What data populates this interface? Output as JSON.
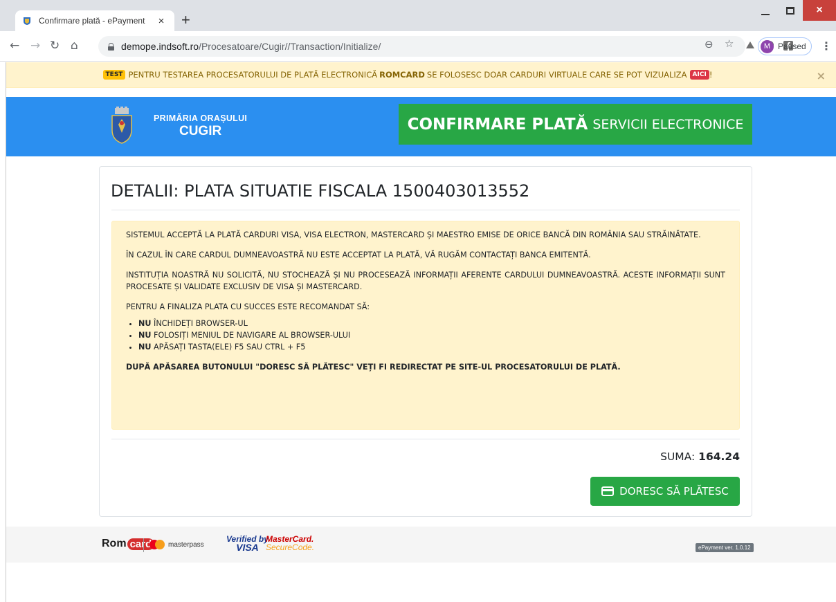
{
  "browser": {
    "tab_title": "Confirmare plată - ePayment",
    "tab_close": "×",
    "new_tab": "+",
    "url_host": "demope.indsoft.ro",
    "url_path": "/Procesatoare/Cugir//Transaction/Initialize/",
    "profile_initial": "M",
    "profile_label": "Paused",
    "close_glyph": "×"
  },
  "test_banner": {
    "badge": "TEST",
    "text_before": "PENTRU TESTAREA PROCESATORULUI DE PLATĂ ELECTRONICĂ",
    "strong": "ROMCARD",
    "text_after": "SE FOLOSESC DOAR CARDURI VIRTUALE CARE SE POT VIZUALIZA",
    "link_badge": "AICI",
    "end": "!",
    "close": "×"
  },
  "header": {
    "brand_line1": "PRIMĂRIA ORAȘULUI",
    "brand_line2": "CUGIR",
    "hero_strong": "CONFIRMARE PLATĂ",
    "hero_light": "SERVICII ELECTRONICE"
  },
  "details": {
    "title": "DETALII: PLATA SITUATIE FISCALA 1500403013552",
    "p1": "SISTEMUL ACCEPTĂ LA PLATĂ CARDURI VISA, VISA ELECTRON, MASTERCARD ȘI MAESTRO EMISE DE ORICE BANCĂ DIN ROMÂNIA SAU STRĂINĂTATE.",
    "p2": "ÎN CAZUL ÎN CARE CARDUL DUMNEAVOASTRĂ NU ESTE ACCEPTAT LA PLATĂ, VĂ RUGĂM CONTACTAȚI BANCA EMITENTĂ.",
    "p3": "INSTITUȚIA NOASTRĂ NU SOLICITĂ, NU STOCHEAZĂ ȘI NU PROCESEAZĂ INFORMAȚII AFERENTE CARDULUI DUMNEAVOASTRĂ. ACESTE INFORMAȚII SUNT PROCESATE ȘI VALIDATE EXCLUSIV DE VISA ȘI MASTERCARD.",
    "p4": "PENTRU A FINALIZA PLATA CU SUCCES ESTE RECOMANDAT SĂ:",
    "items": [
      {
        "strong": "NU",
        "text": "ÎNCHIDEȚI BROWSER-UL"
      },
      {
        "strong": "NU",
        "text": "FOLOSIȚI MENIUL DE NAVIGARE AL BROWSER-ULUI"
      },
      {
        "strong": "NU",
        "text": "APĂSAȚI TASTA(ELE) F5 SAU CTRL + F5"
      }
    ],
    "final": "DUPĂ APĂSAREA BUTONULUI \"DORESC SĂ PLĂTESC\" VEȚI FI REDIRECTAT PE SITE-UL PROCESATORULUI DE PLATĂ.",
    "suma_label": "SUMA:",
    "suma_value": "164.24",
    "pay_label": "DORESC SĂ PLĂTESC"
  },
  "footer": {
    "romcard_a": "Rom",
    "romcard_b": "card",
    "masterpass": "masterpass",
    "vbv_1": "Verified by",
    "vbv_2": "VISA",
    "mc_1": "MasterCard.",
    "mc_2": "SecureCode.",
    "version": "ePayment ver. 1.0.12"
  },
  "colors": {
    "header_blue": "#2b8ff0",
    "green": "#28a745",
    "warning_bg": "#fff3cd"
  }
}
